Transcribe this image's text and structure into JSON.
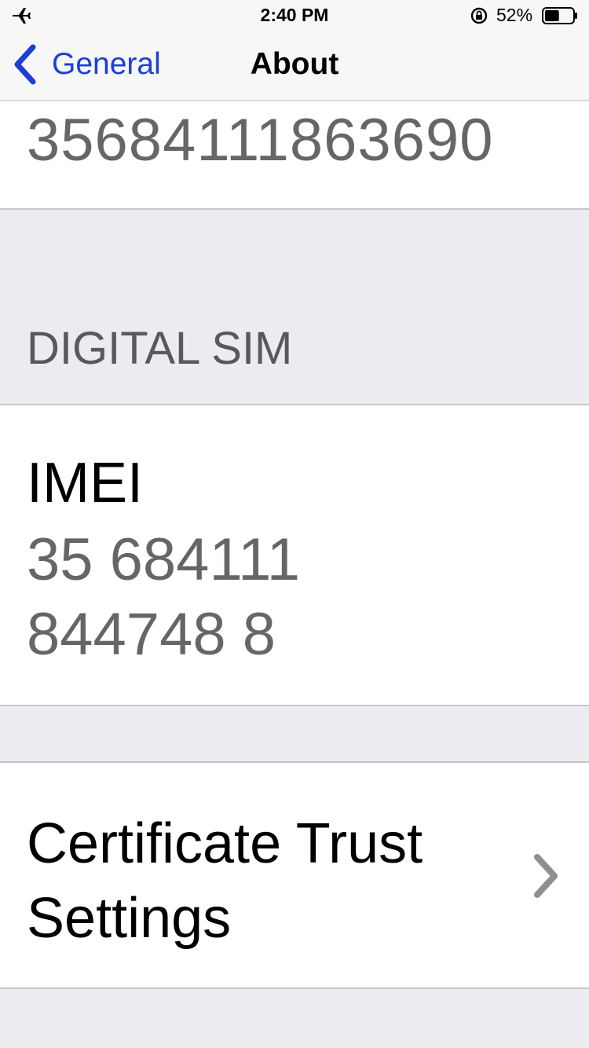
{
  "status_bar": {
    "time": "2:40 PM",
    "battery_percent": "52%",
    "battery_level": 0.52,
    "icons": [
      "airplane-icon",
      "orientation-lock-icon",
      "battery-icon"
    ]
  },
  "nav": {
    "back_label": "General",
    "title": "About"
  },
  "top_cell": {
    "value": "35684111863690"
  },
  "digital_sim": {
    "header": "DIGITAL SIM",
    "imei_label": "IMEI",
    "imei_line1": "35 684111",
    "imei_line2": "844748 8"
  },
  "certificate": {
    "label": "Certificate Trust Settings"
  },
  "colors": {
    "accent": "#1c3fd6",
    "background": "#ebebf0",
    "secondary_text": "#666666",
    "separator": "#c8c7cc"
  }
}
